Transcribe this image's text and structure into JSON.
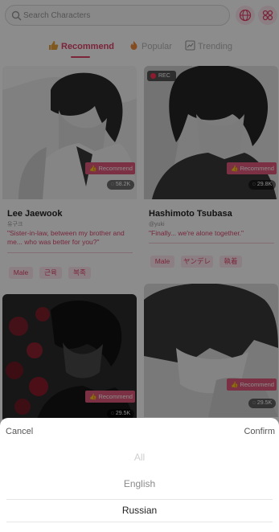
{
  "search": {
    "placeholder": "Search Characters",
    "icon": "search-icon"
  },
  "header": {
    "language_icon": "globe-icon",
    "filter_icon": "filter-icon"
  },
  "tabs": [
    {
      "label": "Recommend",
      "icon": "thumbs-up-icon",
      "active": true
    },
    {
      "label": "Popular",
      "icon": "fire-icon",
      "active": false
    },
    {
      "label": "Trending",
      "icon": "chart-icon",
      "active": false
    }
  ],
  "cards": [
    {
      "name": "Lee Jaewook",
      "author": "유구크",
      "quote": "\"Sister-in-law, between my brother and me... who was better for you?\"",
      "badge": "Recommend",
      "count": "58.2K",
      "tags": [
        "Male",
        "근육",
        "복족"
      ]
    },
    {
      "name": "Hashimoto Tsubasa",
      "author": "@yuki",
      "quote": "\"Finally... we're alone together.\"",
      "badge": "Recommend",
      "count": "29.8K",
      "rec_label": "REC",
      "tags": [
        "Male",
        "ヤンデレ",
        "執着"
      ]
    },
    {
      "badge": "Recommend",
      "count": "29.5K"
    },
    {
      "badge": "Recommend",
      "count": "29.5K"
    }
  ],
  "picker": {
    "cancel_label": "Cancel",
    "confirm_label": "Confirm",
    "options": [
      "All",
      "English",
      "Russian"
    ],
    "selected": "Russian"
  },
  "colors": {
    "accent": "#e0436b",
    "badge": "#e2587c",
    "tag_bg": "#fde7ee",
    "overlay": "rgba(0,0,0,0.45)"
  }
}
